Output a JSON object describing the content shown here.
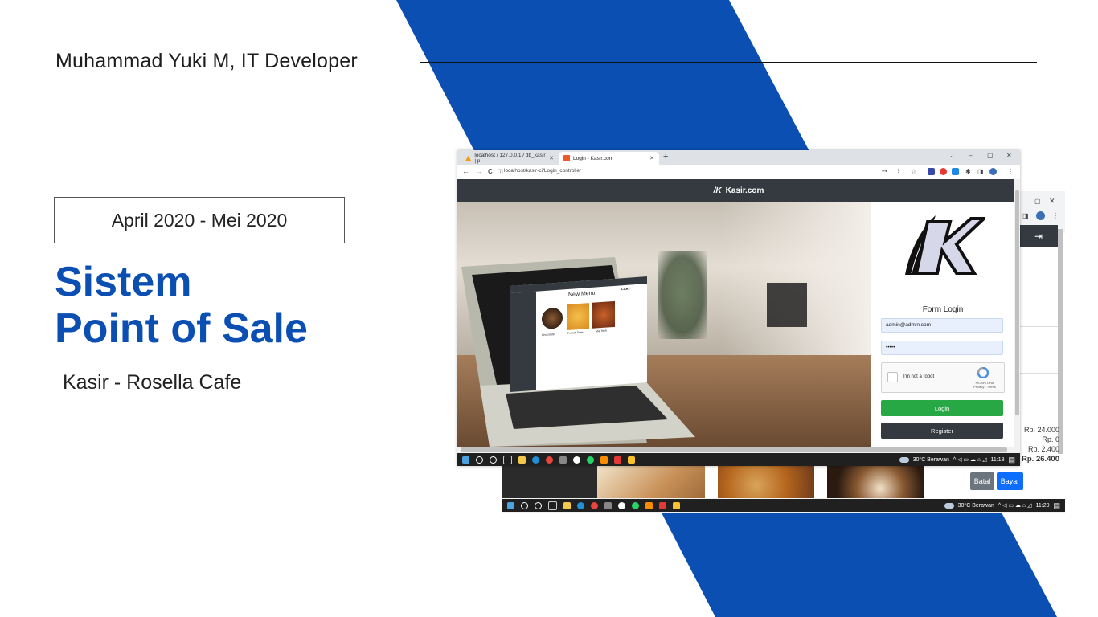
{
  "slide": {
    "author": "Muhammad Yuki M, IT Developer",
    "date_range": "April 2020 - Mei 2020",
    "title_line1": "Sistem",
    "title_line2": "Point of Sale",
    "subtitle": "Kasir - Rosella Cafe"
  },
  "colors": {
    "accent_blue": "#0b4fb3",
    "navbar_dark": "#343a40",
    "login_green": "#28a745",
    "bayar_blue": "#0d6efd",
    "batal_gray": "#6c757d"
  },
  "front_browser": {
    "tabs": [
      {
        "label": "localhost / 127.0.0.1 / db_kasir | p",
        "icon": "phpmyadmin-icon"
      },
      {
        "label": "Login - Kasir.com",
        "icon": "ci-favicon-icon"
      }
    ],
    "new_tab": "+",
    "window_controls": [
      "⌄",
      "–",
      "▢",
      "✕"
    ],
    "nav": {
      "back": "←",
      "forward": "→",
      "reload": "C"
    },
    "url": "localhost/kasir-ci/Login_controller",
    "brand": "Kasir.com",
    "brand_mark": "/K",
    "laptop_screen": {
      "heading": "New Menu",
      "items": [
        "Chocolate",
        "French Fries",
        "Mie Tech"
      ],
      "cart_title": "CART"
    },
    "login": {
      "form_title": "Form Login",
      "email_value": "admin@admin.com",
      "password_value": "•••••",
      "captcha_label": "I'm not a robot",
      "captcha_brand": "reCAPTCHA",
      "captcha_links": "Privacy - Terms",
      "login_button": "Login",
      "register_button": "Register"
    },
    "taskbar": {
      "weather": "30°C Berawan",
      "time": "11:18"
    }
  },
  "back_browser": {
    "amounts": [
      "Rp. 24.000",
      "Rp. 0",
      "Rp. 2.400",
      "Rp. 26.400"
    ],
    "buttons": {
      "batal": "Batal",
      "bayar": "Bayar"
    },
    "taskbar": {
      "weather": "30°C Berawan",
      "time": "11:20"
    }
  }
}
